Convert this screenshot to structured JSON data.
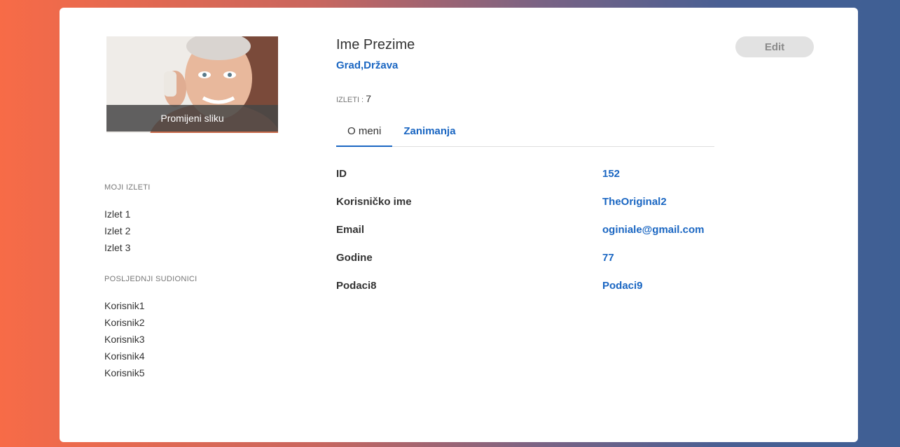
{
  "profile": {
    "photo_caption": "Promijeni sliku",
    "name": "Ime Prezime",
    "location": "Grad,Država",
    "trips_label": "IZLETI : ",
    "trips_count": "7",
    "edit_label": "Edit"
  },
  "sidebar": {
    "trips_heading": "MOJI IZLETI",
    "trips": [
      "Izlet 1",
      "Izlet 2",
      "Izlet 3"
    ],
    "participants_heading": "POSLJEDNJI SUDIONICI",
    "participants": [
      "Korisnik1",
      "Korisnik2",
      "Korisnik3",
      "Korisnik4",
      "Korisnik5"
    ]
  },
  "tabs": [
    {
      "label": "O meni",
      "active": true
    },
    {
      "label": "Zanimanja",
      "active": false
    }
  ],
  "info": [
    {
      "key": "ID",
      "value": "152"
    },
    {
      "key": "Korisničko ime",
      "value": "TheOriginal2"
    },
    {
      "key": "Email",
      "value": "oginiale@gmail.com"
    },
    {
      "key": "Godine",
      "value": "77"
    },
    {
      "key": "Podaci8",
      "value": "Podaci9"
    }
  ],
  "colors": {
    "accent": "#1a66c2",
    "edit_bg": "#e2e2e2"
  }
}
